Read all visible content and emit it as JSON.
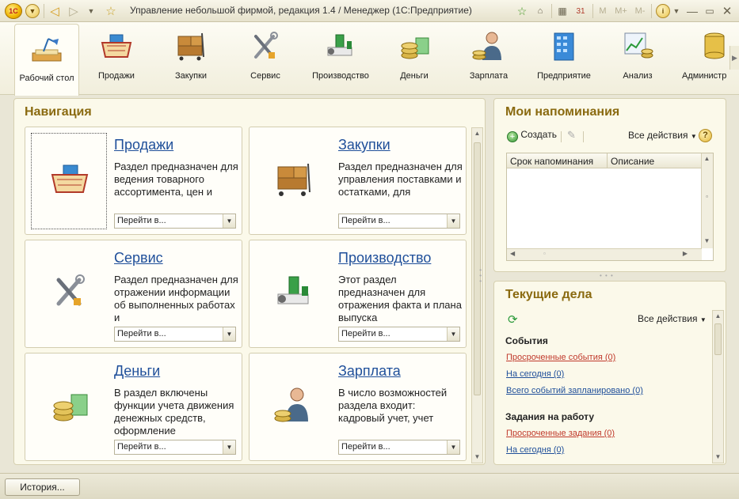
{
  "window": {
    "title": "Управление небольшой фирмой, редакция 1.4 / Менеджер  (1С:Предприятие)",
    "logo": "1С",
    "toolbar_right": [
      "M",
      "M+",
      "M-"
    ]
  },
  "sections": [
    {
      "label": "Рабочий стол",
      "icon": "desk-lamp-icon",
      "active": true
    },
    {
      "label": "Продажи",
      "icon": "shopping-basket-icon",
      "active": false
    },
    {
      "label": "Закупки",
      "icon": "boxes-cart-icon",
      "active": false
    },
    {
      "label": "Сервис",
      "icon": "tools-icon",
      "active": false
    },
    {
      "label": "Производство",
      "icon": "factory-icon",
      "active": false
    },
    {
      "label": "Деньги",
      "icon": "coins-icon",
      "active": false
    },
    {
      "label": "Зарплата",
      "icon": "employee-icon",
      "active": false
    },
    {
      "label": "Предприятие",
      "icon": "building-icon",
      "active": false
    },
    {
      "label": "Анализ",
      "icon": "analysis-chart-icon",
      "active": false
    },
    {
      "label": "Администр",
      "icon": "database-icon",
      "active": false
    }
  ],
  "navigation": {
    "title": "Навигация",
    "cards": [
      {
        "title": "Продажи",
        "desc": "Раздел предназначен для ведения товарного ассортимента, цен и",
        "select": "Перейти в...",
        "icon": "shopping-basket-icon"
      },
      {
        "title": "Закупки",
        "desc": "Раздел предназначен для управления поставками и остатками, для",
        "select": "Перейти в...",
        "icon": "boxes-cart-icon"
      },
      {
        "title": "Сервис",
        "desc": "Раздел предназначен для отражении информации об выполненных работах и",
        "select": "Перейти в...",
        "icon": "tools-icon"
      },
      {
        "title": "Производство",
        "desc": "Этот раздел предназначен для отражения факта и плана выпуска",
        "select": "Перейти в...",
        "icon": "factory-icon"
      },
      {
        "title": "Деньги",
        "desc": "В раздел включены функции учета движения денежных средств, оформление",
        "select": "Перейти в...",
        "icon": "coins-icon"
      },
      {
        "title": "Зарплата",
        "desc": "В число возможностей раздела входит: кадровый учет, учет",
        "select": "Перейти в...",
        "icon": "employee-icon"
      }
    ]
  },
  "reminders": {
    "title": "Мои напоминания",
    "create": "Создать",
    "all_actions": "Все действия",
    "columns": [
      "Срок напоминания",
      "Описание"
    ]
  },
  "todo": {
    "title": "Текущие дела",
    "all_actions": "Все действия",
    "events_title": "События",
    "events": [
      {
        "text": "Просроченные события (0)",
        "color": "#c0392b"
      },
      {
        "text": "На сегодня (0)",
        "color": "#1f4f9a"
      },
      {
        "text": "Всего событий запланировано (0)",
        "color": "#1f4f9a"
      }
    ],
    "tasks_title": "Задания на работу",
    "tasks": [
      {
        "text": "Просроченные задания (0)",
        "color": "#c0392b"
      },
      {
        "text": "На сегодня (0)",
        "color": "#1f4f9a"
      }
    ]
  },
  "bottom": {
    "history": "История..."
  }
}
